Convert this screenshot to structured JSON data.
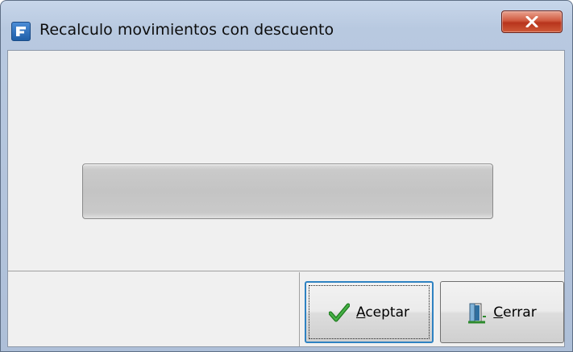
{
  "window": {
    "title": "Recalculo movimientos con descuento"
  },
  "progress": {
    "value_fraction": 0.0,
    "fill_color": "#3fb34f",
    "track_color": "#c4c4c4"
  },
  "buttons": {
    "accept": {
      "mnemonic": "A",
      "rest": "ceptar",
      "icon": "checkmark-icon"
    },
    "close": {
      "mnemonic": "C",
      "rest": "errar",
      "icon": "door-exit-icon"
    }
  },
  "colors": {
    "accent_focus": "#2e82c2",
    "close_button": "#c8432a"
  }
}
